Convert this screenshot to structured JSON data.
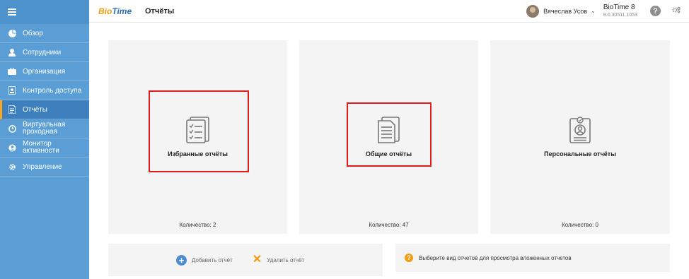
{
  "sidebar": {
    "items": [
      {
        "label": "Обзор",
        "icon": "pie-chart-icon"
      },
      {
        "label": "Сотрудники",
        "icon": "person-icon"
      },
      {
        "label": "Организация",
        "icon": "briefcase-icon"
      },
      {
        "label": "Контроль доступа",
        "icon": "badge-icon"
      },
      {
        "label": "Отчёты",
        "icon": "document-icon",
        "active": true
      },
      {
        "label": "Виртуальная проходная",
        "icon": "clock-icon"
      },
      {
        "label": "Монитор активности",
        "icon": "user-circle-icon"
      },
      {
        "label": "Управление",
        "icon": "gear-icon"
      }
    ]
  },
  "header": {
    "logo_part1": "Bio",
    "logo_part2": "Time",
    "title": "Отчёты",
    "user_name": "Вячеслав Усов",
    "product": "BioTime 8",
    "version": "8.0.30511.1053"
  },
  "cards": [
    {
      "title": "Избранные отчёты",
      "count": "Количество: 2"
    },
    {
      "title": "Общие отчёты",
      "count": "Количество: 47"
    },
    {
      "title": "Персональные отчёты",
      "count": "Количество: 0"
    }
  ],
  "actions": {
    "add": "Добавить отчёт",
    "delete": "Удалить отчёт"
  },
  "hint": "Выберите вид отчетов для просмотра вложенных отчетов",
  "colors": {
    "sidebar": "#5b9ed5",
    "active_marker": "#f5a623",
    "highlight_box": "#e21b1b",
    "add_button": "#4d8ed0",
    "delete_icon": "#f39c12"
  }
}
